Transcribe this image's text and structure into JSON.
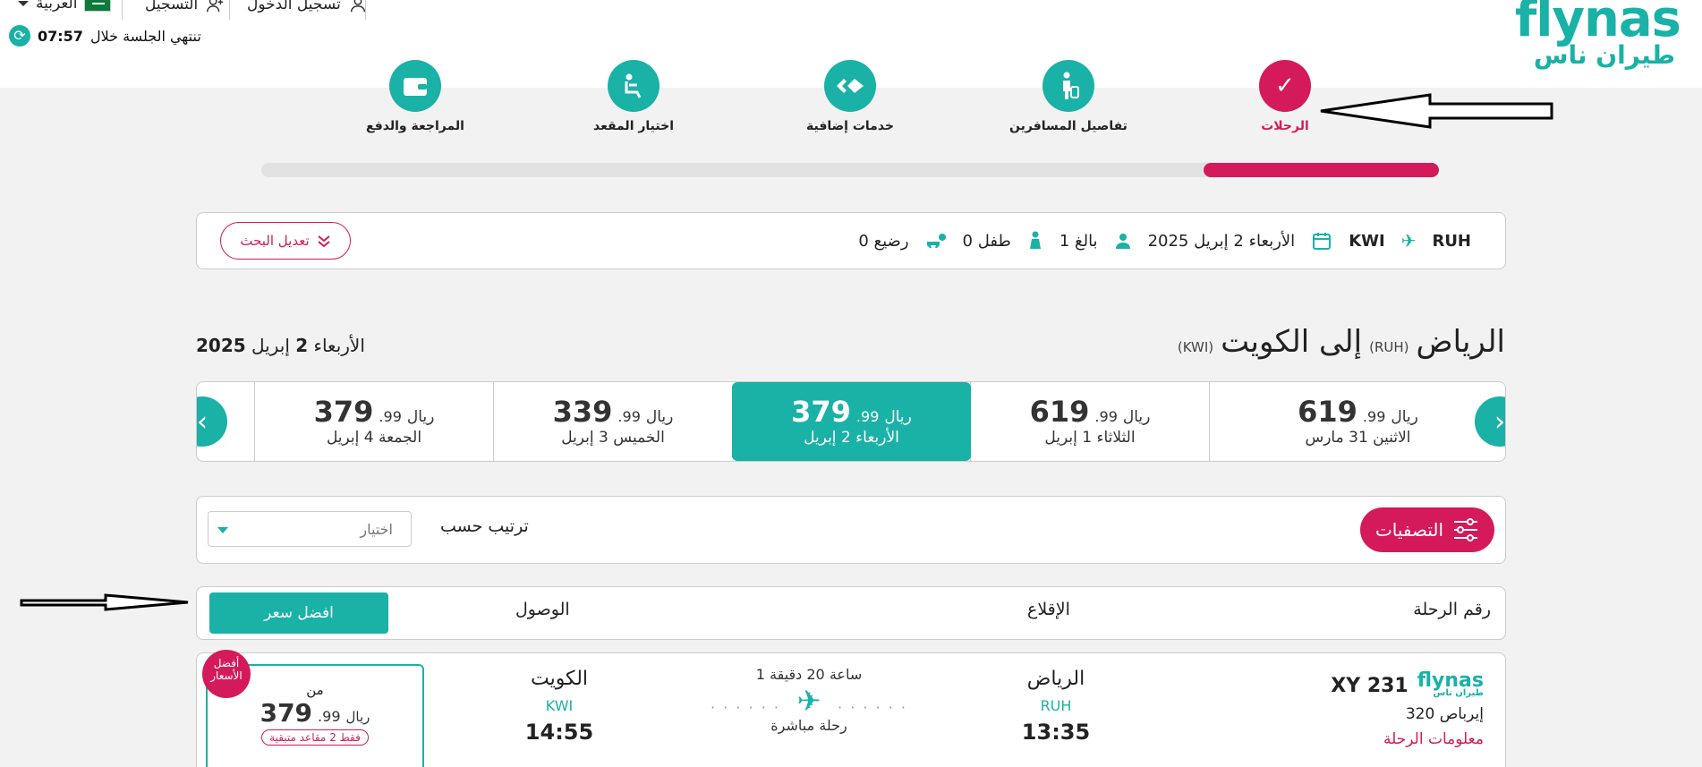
{
  "header": {
    "brand_latin": "flynas",
    "brand_arabic": "طيران ناس",
    "language": "العربية",
    "register": "التسجيل",
    "login": "تسجيل الدخول",
    "session_text": "تنتهي الجلسة خلال",
    "session_timer": "07:57"
  },
  "steps": [
    {
      "label": "الرحلات",
      "icon": "check-icon",
      "active": true
    },
    {
      "label": "تفاصيل المسافرين",
      "icon": "traveler-icon",
      "active": false
    },
    {
      "label": "خدمات إضافية",
      "icon": "extras-icon",
      "active": false
    },
    {
      "label": "اختيار المقعد",
      "icon": "seat-icon",
      "active": false
    },
    {
      "label": "المراجعة والدفع",
      "icon": "wallet-icon",
      "active": false
    }
  ],
  "progress": {
    "fraction": 0.2
  },
  "summary": {
    "origin": "RUH",
    "destination": "KWI",
    "date": "الأربعاء 2 إبريل 2025",
    "adults": "1 بالغ",
    "children": "0 طفل",
    "infants": "0 رضيع",
    "modify_label": "تعديل البحث"
  },
  "route": {
    "from_city": "الرياض",
    "from_code": "(RUH)",
    "to_word": "إلى الكويت",
    "to_code": "(KWI)",
    "date_prefix": "الأربعاء",
    "date_day": "2",
    "date_month": "إبريل",
    "date_year": "2025"
  },
  "dates": [
    {
      "main": "619",
      "dec": ".99",
      "cur": "ريال",
      "label": "الاثنين 31 مارس",
      "selected": false
    },
    {
      "main": "619",
      "dec": ".99",
      "cur": "ريال",
      "label": "الثلاثاء 1 إبريل",
      "selected": false
    },
    {
      "main": "379",
      "dec": ".99",
      "cur": "ريال",
      "label": "الأربعاء 2 إبريل",
      "selected": true
    },
    {
      "main": "339",
      "dec": ".99",
      "cur": "ريال",
      "label": "الخميس 3 إبريل",
      "selected": false
    },
    {
      "main": "379",
      "dec": ".99",
      "cur": "ريال",
      "label": "الجمعة 4 إبريل",
      "selected": false
    }
  ],
  "filterbar": {
    "filters_label": "التصفيات",
    "sort_label": "ترتيب حسب",
    "sort_placeholder": "اختيار"
  },
  "columns": {
    "flight_no": "رقم الرحلة",
    "departure": "الإقلاع",
    "arrival": "الوصول",
    "best_price": "افضل سعر"
  },
  "flight": {
    "logo": "flynas",
    "logo_ar": "طيران ناس",
    "number": "XY 231",
    "aircraft": "إيرباص 320",
    "info_link": "معلومات الرحلة",
    "dep_city": "الرياض",
    "dep_code": "RUH",
    "dep_time": "13:35",
    "duration": "1 ساعة 20 دقيقة",
    "type": "رحلة مباشرة",
    "arr_city": "الكويت",
    "arr_code": "KWI",
    "arr_time": "14:55",
    "badge_line1": "أفضل",
    "badge_line2": "الأسعار",
    "from_label": "من",
    "price_main": "379",
    "price_dec": ".99",
    "price_cur": "ريال",
    "seats_left": "فقط 2 مقاعد متبقية"
  },
  "colors": {
    "teal": "#1ab1a7",
    "pink": "#d41a5b"
  }
}
